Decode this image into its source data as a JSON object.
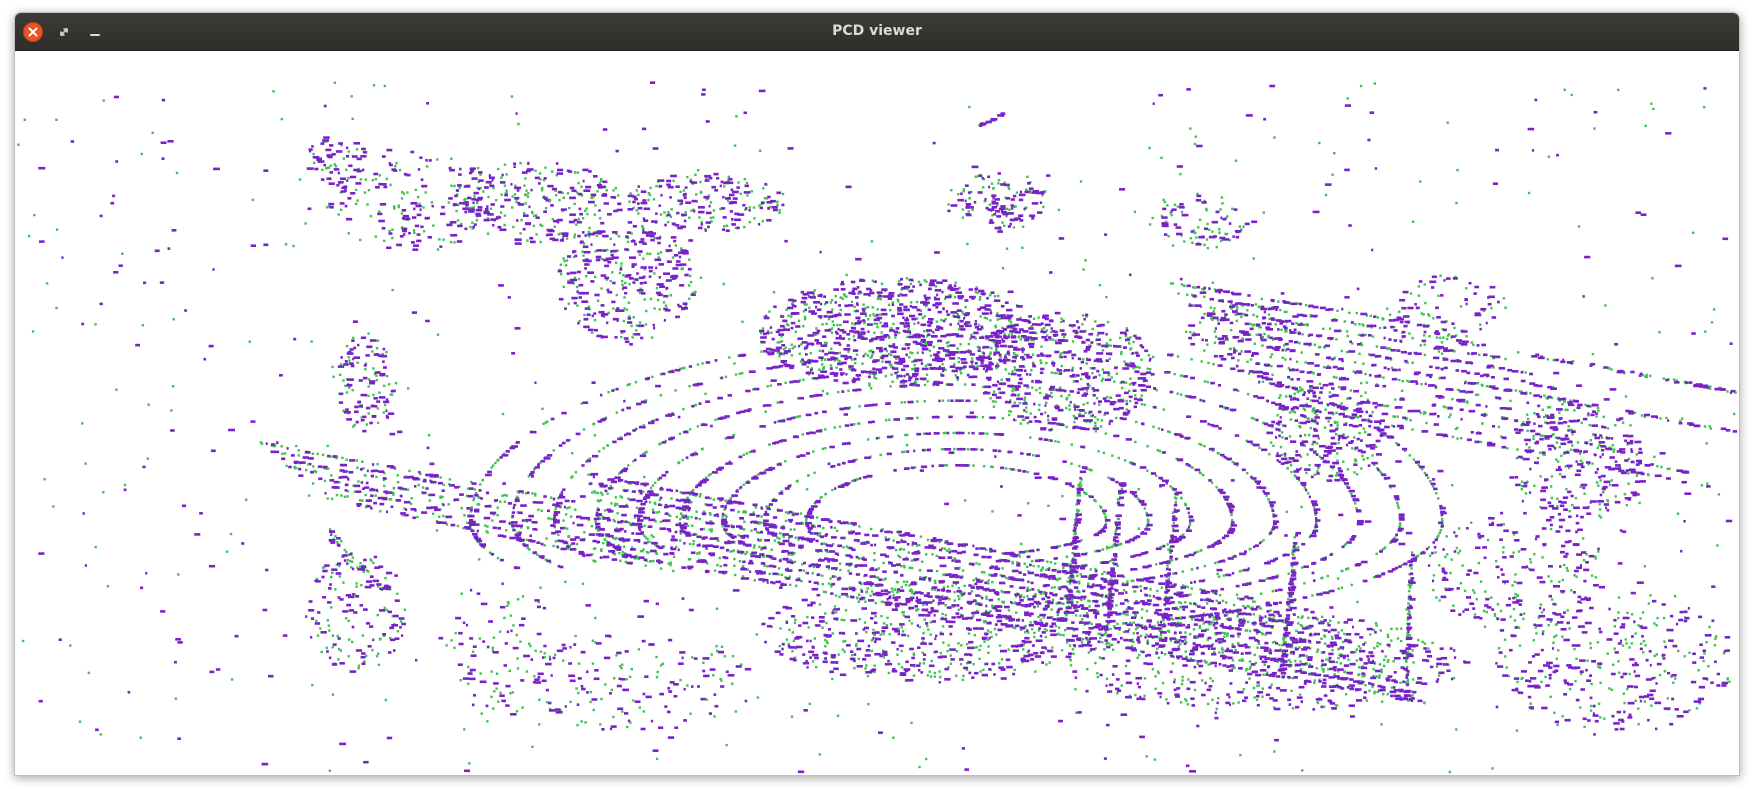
{
  "window": {
    "title": "PCD viewer",
    "buttons": {
      "close": "close-icon",
      "maximize": "maximize-icon",
      "minimize": "minimize-icon"
    }
  },
  "viewer": {
    "background": "#ffffff",
    "cloud_colors": {
      "cloud_a": "#7a22c9",
      "cloud_b": "#3fc24f"
    }
  },
  "colors": {
    "titlebar": "#3c3b37",
    "title_text": "#dfdbd2",
    "close_button": "#e95420"
  }
}
